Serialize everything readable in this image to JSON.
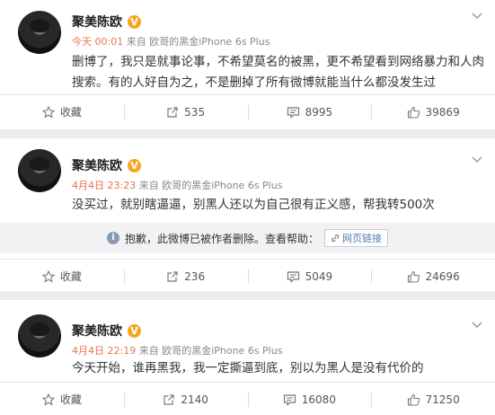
{
  "posts": [
    {
      "username": "聚美陈欧",
      "vip_badge": "V",
      "time": "今天 00:01",
      "source": " 来自 欧哥的黑金iPhone 6s Plus",
      "content": "删博了，我只是就事论事，不希望莫名的被黑，更不希望看到网络暴力和人肉搜索。有的人好自为之，不是删掉了所有微博就能当什么都没发生过",
      "actions": {
        "favorite": "收藏",
        "repost": "535",
        "comment": "8995",
        "like": "39869"
      }
    },
    {
      "username": "聚美陈欧",
      "vip_badge": "V",
      "time": "4月4日 23:23",
      "source": " 来自 欧哥的黑金iPhone 6s Plus",
      "content": "没买过，就别瞎逼逼，别黑人还以为自己很有正义感，帮我转500次",
      "notice": {
        "text": "抱歉，此微博已被作者删除。查看帮助：",
        "link": "网页链接"
      },
      "actions": {
        "favorite": "收藏",
        "repost": "236",
        "comment": "5049",
        "like": "24696"
      }
    },
    {
      "username": "聚美陈欧",
      "vip_badge": "V",
      "time": "4月4日 22:19",
      "source": " 来自 欧哥的黑金iPhone 6s Plus",
      "content": "今天开始，谁再黑我，我一定撕逼到底，别以为黑人是没有代价的",
      "actions": {
        "favorite": "收藏",
        "repost": "2140",
        "comment": "16080",
        "like": "71250"
      }
    }
  ],
  "icons": {
    "favorite": "star-icon",
    "repost": "repost-icon",
    "comment": "comment-icon",
    "like": "thumbs-up-icon",
    "menu": "chevron-down-icon",
    "notice": "info-icon",
    "link": "link-icon"
  },
  "colors": {
    "time": "#eb7350",
    "vip": "#f6a623",
    "link": "#507daf"
  }
}
